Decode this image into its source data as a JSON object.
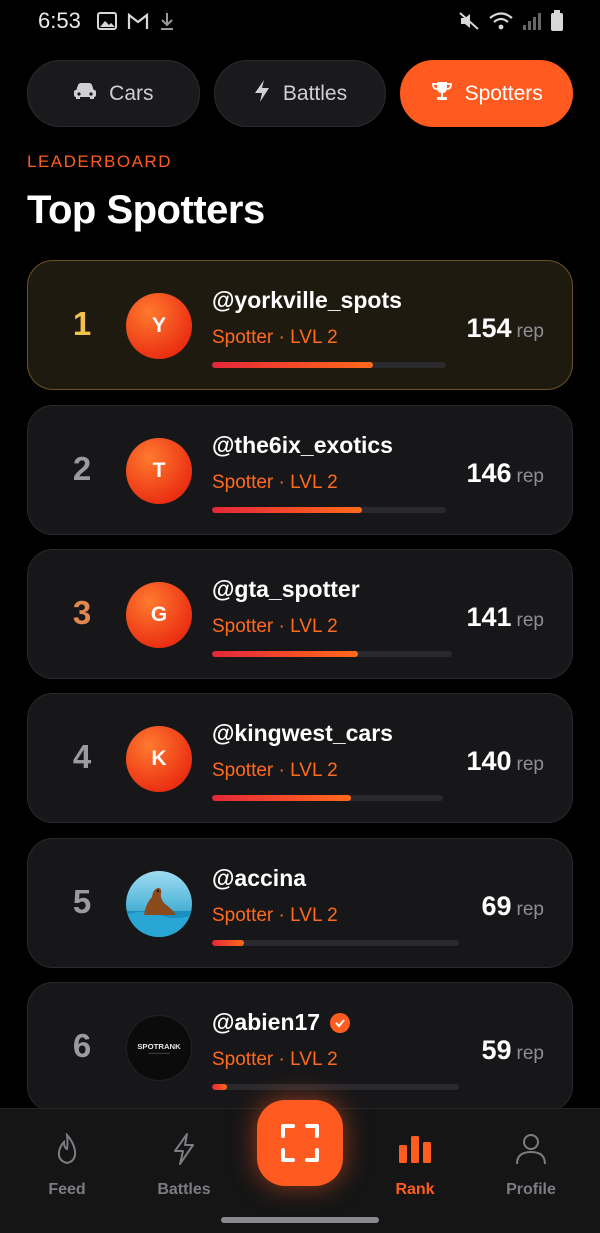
{
  "status_bar": {
    "time": "6:53",
    "left_icons": [
      "image-icon",
      "gmail-icon",
      "download-icon"
    ],
    "right_icons": [
      "mute-icon",
      "wifi-icon",
      "signal-icon",
      "battery-icon"
    ]
  },
  "tabs": [
    {
      "label": "Cars",
      "icon": "car-icon",
      "active": false
    },
    {
      "label": "Battles",
      "icon": "lightning-icon",
      "active": false
    },
    {
      "label": "Spotters",
      "icon": "trophy-icon",
      "active": true
    }
  ],
  "section_label": "LEADERBOARD",
  "page_title": "Top Spotters",
  "leaderboard": [
    {
      "rank": "1",
      "initial": "Y",
      "username": "@yorkville_spots",
      "level": "Spotter · LVL 2",
      "rep": "154",
      "rep_unit": "rep",
      "progress": 0.69,
      "verified": false
    },
    {
      "rank": "2",
      "initial": "T",
      "username": "@the6ix_exotics",
      "level": "Spotter · LVL 2",
      "rep": "146",
      "rep_unit": "rep",
      "progress": 0.64,
      "verified": false
    },
    {
      "rank": "3",
      "initial": "G",
      "username": "@gta_spotter",
      "level": "Spotter · LVL 2",
      "rep": "141",
      "rep_unit": "rep",
      "progress": 0.61,
      "verified": false
    },
    {
      "rank": "4",
      "initial": "K",
      "username": "@kingwest_cars",
      "level": "Spotter · LVL 2",
      "rep": "140",
      "rep_unit": "rep",
      "progress": 0.6,
      "verified": false
    },
    {
      "rank": "5",
      "initial": "",
      "username": "@accina",
      "level": "Spotter · LVL 2",
      "rep": "69",
      "rep_unit": "rep",
      "progress": 0.13,
      "verified": false
    },
    {
      "rank": "6",
      "initial": "",
      "username": "@abien17",
      "level": "Spotter · LVL 2",
      "rep": "59",
      "rep_unit": "rep",
      "progress": 0.06,
      "verified": true
    }
  ],
  "avatar_logo_text": "SPOTRANK",
  "bottom_nav": [
    {
      "label": "Feed",
      "icon": "flame-icon",
      "active": false
    },
    {
      "label": "Battles",
      "icon": "lightning-icon",
      "active": false
    },
    {
      "label": "Rank",
      "icon": "bar-chart-icon",
      "active": true
    },
    {
      "label": "Profile",
      "icon": "person-icon",
      "active": false
    }
  ],
  "scan_button_icon": "scan-frame-icon",
  "colors": {
    "accent": "#ff5a1f",
    "background": "#000000",
    "card": "#171719",
    "first_card": "#1f1a10",
    "gold": "#f2c14e",
    "bronze": "#e1884f"
  }
}
